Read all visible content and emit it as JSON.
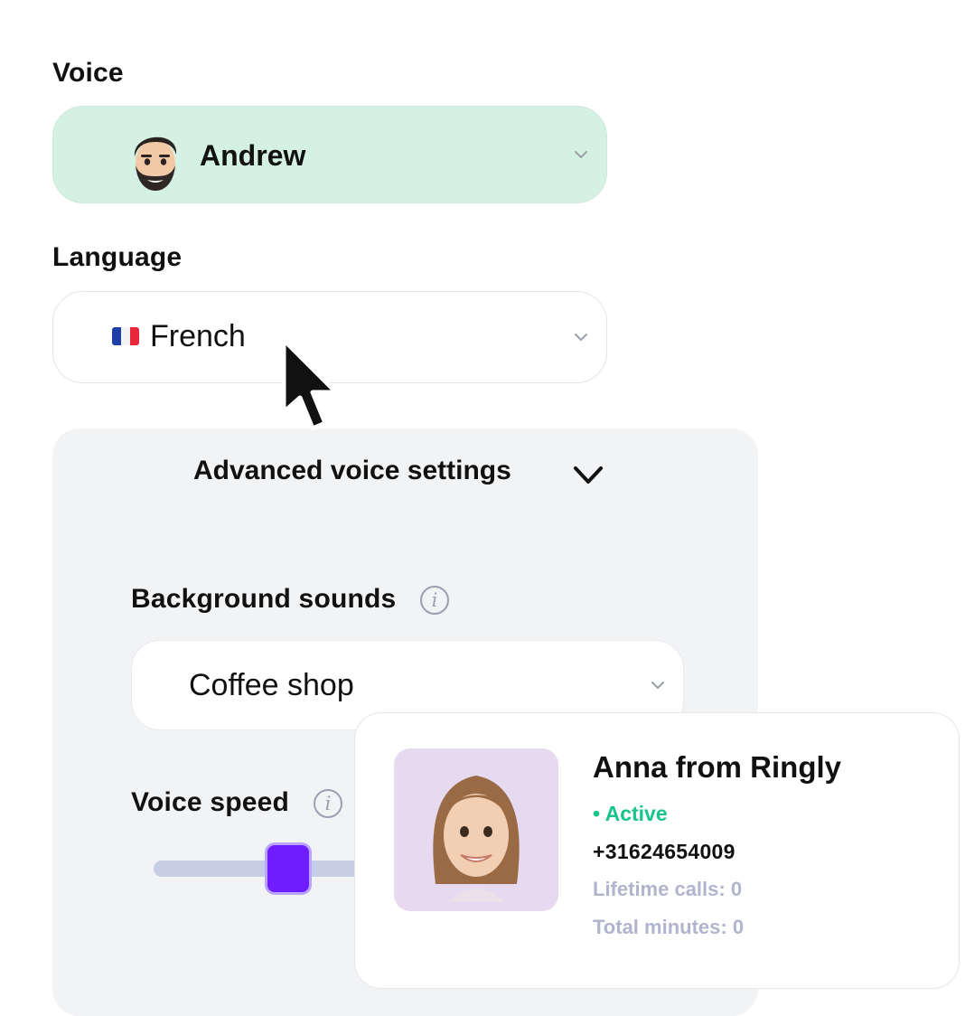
{
  "voice": {
    "label": "Voice",
    "selected": "Andrew",
    "avatar_icon": "male-memoji-avatar",
    "bg_color": "#d4f1e3"
  },
  "language": {
    "label": "Language",
    "selected": "French",
    "flag_icon": "france-flag-icon"
  },
  "advanced": {
    "title": "Advanced voice settings",
    "chevron_icon": "chevron-down-icon",
    "background_sounds": {
      "label": "Background sounds",
      "info_icon": "info-icon",
      "selected": "Coffee shop"
    },
    "voice_speed": {
      "label": "Voice speed",
      "info_icon": "info-icon",
      "slider_value_fraction": 0.52,
      "thumb_color": "#6f1cff",
      "track_color": "#c6cee6"
    }
  },
  "profile_card": {
    "name": "Anna from Ringly",
    "status": "• Active",
    "status_color": "#17c48c",
    "phone": "+31624654009",
    "lifetime_calls": "Lifetime calls: 0",
    "total_minutes": "Total minutes: 0",
    "avatar_icon": "female-memoji-avatar",
    "avatar_bg": "#e6d9f0"
  },
  "cursor_icon": "mouse-pointer-icon"
}
